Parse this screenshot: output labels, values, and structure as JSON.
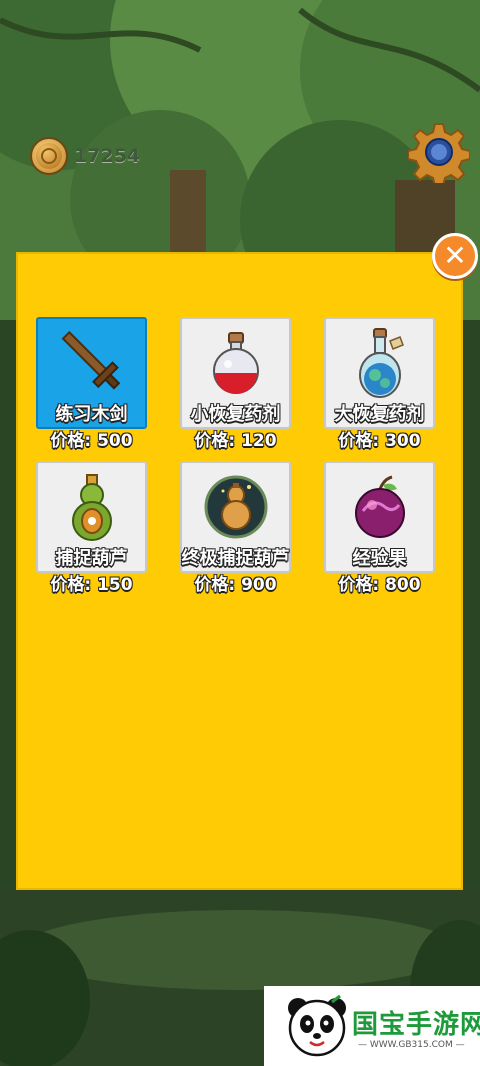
{
  "currency": {
    "amount": "17254",
    "icon": "coin-icon"
  },
  "settings": {
    "icon": "gear-icon"
  },
  "close": {
    "label": "✕",
    "icon": "close-icon"
  },
  "shop": {
    "items": [
      {
        "name": "练习木剑",
        "price": "价格: 500",
        "icon": "wooden-sword-icon",
        "selected": true
      },
      {
        "name": "小恢复药剂",
        "price": "价格: 120",
        "icon": "red-potion-icon",
        "selected": false
      },
      {
        "name": "大恢复药剂",
        "price": "价格: 300",
        "icon": "blue-potion-icon",
        "selected": false
      },
      {
        "name": "捕捉葫芦",
        "price": "价格: 150",
        "icon": "green-gourd-icon",
        "selected": false
      },
      {
        "name": "终极捕捉葫芦",
        "price": "价格: 900",
        "icon": "golden-gourd-icon",
        "selected": false
      },
      {
        "name": "经验果",
        "price": "价格: 800",
        "icon": "exp-fruit-icon",
        "selected": false
      }
    ]
  },
  "watermark": {
    "title": "国宝手游网",
    "url": "— WWW.GB315.COM —"
  },
  "colors": {
    "panel": "#ffcb05",
    "selected_card": "#1aa3e6",
    "close_button": "#f58a2b"
  }
}
